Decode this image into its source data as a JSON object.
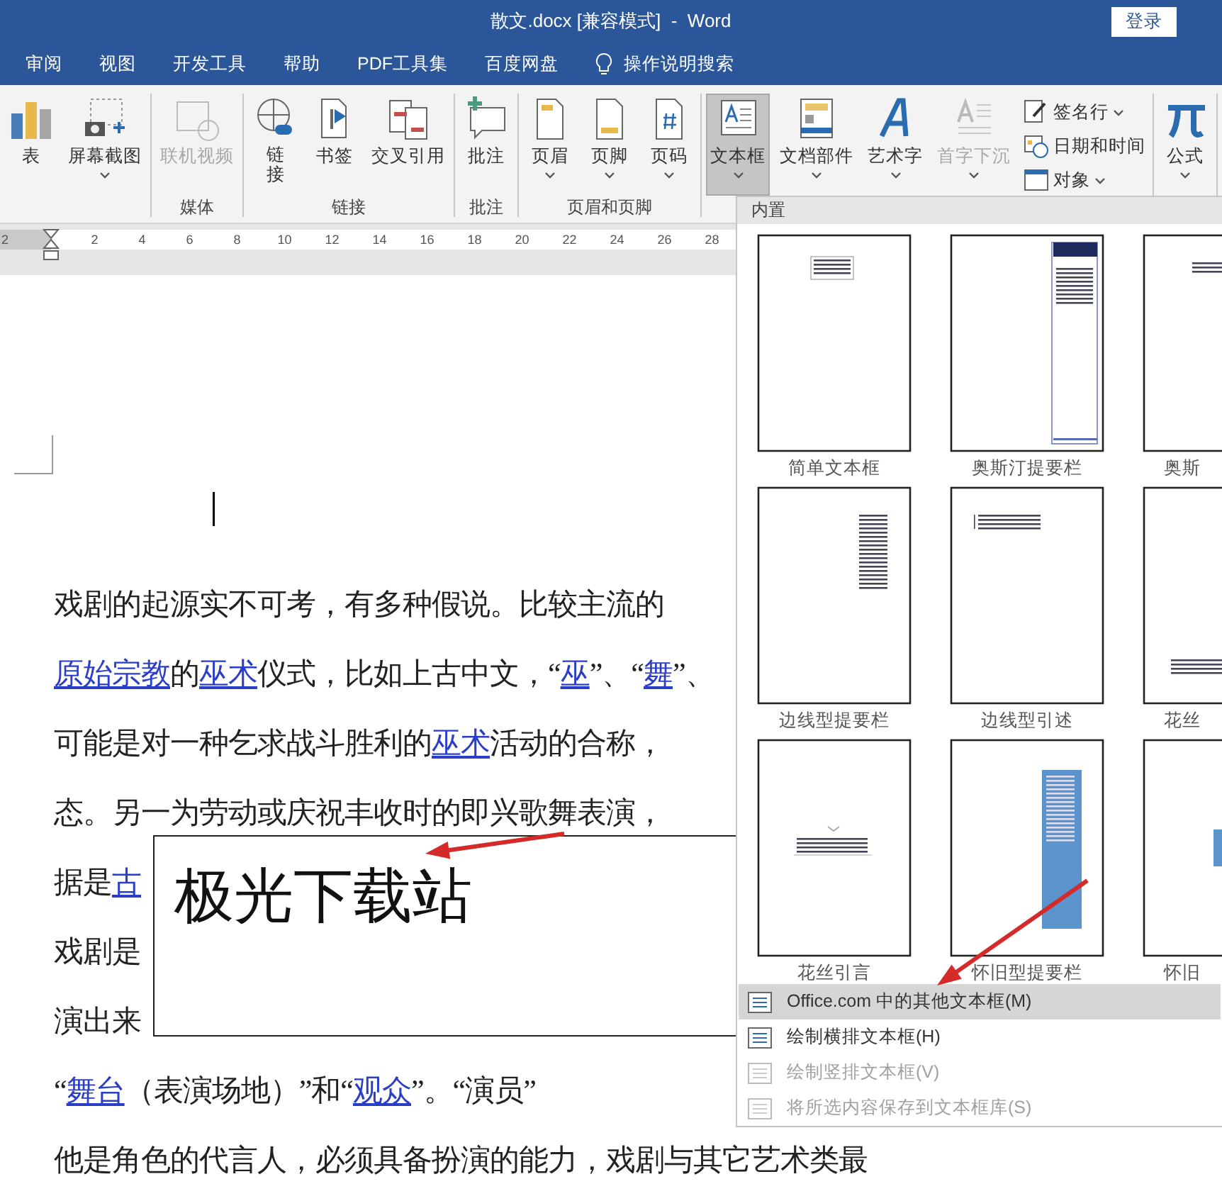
{
  "window": {
    "title": "散文.docx [兼容模式]  -  Word",
    "login": "登录"
  },
  "tabs": [
    {
      "label": "审阅",
      "kind": "tab"
    },
    {
      "label": "视图",
      "kind": "tab"
    },
    {
      "label": "开发工具",
      "kind": "tab"
    },
    {
      "label": "帮助",
      "kind": "tab"
    },
    {
      "label": "PDF工具集",
      "kind": "tab"
    },
    {
      "label": "百度网盘",
      "kind": "tab"
    },
    {
      "label": "操作说明搜索",
      "kind": "search"
    }
  ],
  "ribbon": {
    "groups": [
      {
        "buttons": [
          {
            "label": "表",
            "kind": "large",
            "caret": false,
            "disabled": false,
            "selected": false
          },
          {
            "label": "屏幕截图",
            "kind": "large",
            "caret": true,
            "disabled": false,
            "selected": false
          }
        ]
      },
      {
        "label": "媒体",
        "buttons": [
          {
            "label": "联机视频",
            "kind": "large",
            "caret": false,
            "disabled": true,
            "selected": false
          }
        ]
      },
      {
        "label": "链接",
        "buttons": [
          {
            "label": "链接",
            "kind": "stacked",
            "caret": false,
            "disabled": false,
            "selected": false
          },
          {
            "label": "书签",
            "kind": "large",
            "caret": false,
            "disabled": false,
            "selected": false
          },
          {
            "label": "交叉引用",
            "kind": "large",
            "caret": false,
            "disabled": false,
            "selected": false
          }
        ]
      },
      {
        "label": "批注",
        "buttons": [
          {
            "label": "批注",
            "kind": "large",
            "caret": false,
            "disabled": false,
            "selected": false
          }
        ]
      },
      {
        "label": "页眉和页脚",
        "buttons": [
          {
            "label": "页眉",
            "kind": "large",
            "caret": true,
            "disabled": false,
            "selected": false
          },
          {
            "label": "页脚",
            "kind": "large",
            "caret": true,
            "disabled": false,
            "selected": false
          },
          {
            "label": "页码",
            "kind": "large",
            "caret": true,
            "disabled": false,
            "selected": false
          }
        ]
      },
      {
        "buttons": [
          {
            "label": "文本框",
            "kind": "large",
            "caret": true,
            "disabled": false,
            "selected": true
          },
          {
            "label": "文档部件",
            "kind": "large",
            "caret": true,
            "disabled": false,
            "selected": false
          },
          {
            "label": "艺术字",
            "kind": "large",
            "caret": true,
            "disabled": false,
            "selected": false
          },
          {
            "label": "首字下沉",
            "kind": "large",
            "caret": true,
            "disabled": true,
            "selected": false
          },
          {
            "label": "签名行",
            "kind": "small",
            "caret": true,
            "disabled": false,
            "selected": false
          },
          {
            "label": "日期和时间",
            "kind": "small",
            "caret": false,
            "disabled": false,
            "selected": false
          },
          {
            "label": "对象",
            "kind": "small",
            "caret": true,
            "disabled": false,
            "selected": false
          }
        ]
      },
      {
        "buttons": [
          {
            "label": "公式",
            "kind": "large",
            "caret": true,
            "disabled": false,
            "selected": false
          }
        ]
      }
    ]
  },
  "ruler": {
    "ticks": [
      "2",
      "2",
      "4",
      "6",
      "8",
      "10",
      "12",
      "14",
      "16",
      "18",
      "20",
      "22",
      "24",
      "26",
      "28"
    ]
  },
  "document": {
    "paragraph_lines": [
      [
        {
          "text": "戏剧的起源实不可考，有多种假说。比较主流的",
          "link": false
        }
      ],
      [
        {
          "text": "原始宗教",
          "link": true
        },
        {
          "text": "的",
          "link": false
        },
        {
          "text": "巫术",
          "link": true
        },
        {
          "text": "仪式，比如上古中文，“",
          "link": false
        },
        {
          "text": "巫",
          "link": true
        },
        {
          "text": "”、“",
          "link": false
        },
        {
          "text": "舞",
          "link": true
        },
        {
          "text": "”、",
          "link": false
        }
      ],
      [
        {
          "text": "可能是对一种乞求战斗胜利的",
          "link": false
        },
        {
          "text": "巫术",
          "link": true
        },
        {
          "text": "活动的合称，",
          "link": false
        }
      ],
      [
        {
          "text": "态。另一为劳动或庆祝丰收时的即兴歌舞表演，",
          "link": false
        }
      ],
      [
        {
          "text": "据是",
          "link": false
        },
        {
          "text": "古",
          "link": true
        }
      ],
      [
        {
          "text": "戏剧是",
          "link": false
        }
      ],
      [
        {
          "text": "演出来",
          "link": false
        }
      ],
      [
        {
          "text": "“",
          "link": false
        },
        {
          "text": "舞台",
          "link": true
        },
        {
          "text": "（表演场地）”和“",
          "link": false
        },
        {
          "text": "观众",
          "link": true
        },
        {
          "text": "”。“演员”",
          "link": false
        }
      ],
      [
        {
          "text": "他是角色的代言人，必须具备扮演的能力，戏剧与其它艺术类最",
          "link": false
        }
      ]
    ],
    "text_box": {
      "text": "极光下载站"
    }
  },
  "dropdown": {
    "header": "内置",
    "templates": [
      {
        "label": "简单文本框",
        "kind": "simple"
      },
      {
        "label": "奥斯汀提要栏",
        "kind": "austin"
      },
      {
        "label": "奥斯",
        "kind": "austin-quote"
      },
      {
        "label": "边线型提要栏",
        "kind": "sideline"
      },
      {
        "label": "边线型引述",
        "kind": "sideline-quote"
      },
      {
        "label": "花丝",
        "kind": "filigree-sidebar"
      },
      {
        "label": "花丝引言",
        "kind": "filigree"
      },
      {
        "label": "怀旧型提要栏",
        "kind": "retro"
      },
      {
        "label": "怀旧",
        "kind": "retro-quote"
      }
    ],
    "menu": [
      {
        "label": "Office.com 中的其他文本框(M)",
        "selected": true,
        "disabled": false
      },
      {
        "label": "绘制横排文本框(H)",
        "selected": false,
        "disabled": false
      },
      {
        "label": "绘制竖排文本框(V)",
        "selected": false,
        "disabled": true
      },
      {
        "label": "将所选内容保存到文本框库(S)",
        "selected": false,
        "disabled": true
      }
    ]
  }
}
